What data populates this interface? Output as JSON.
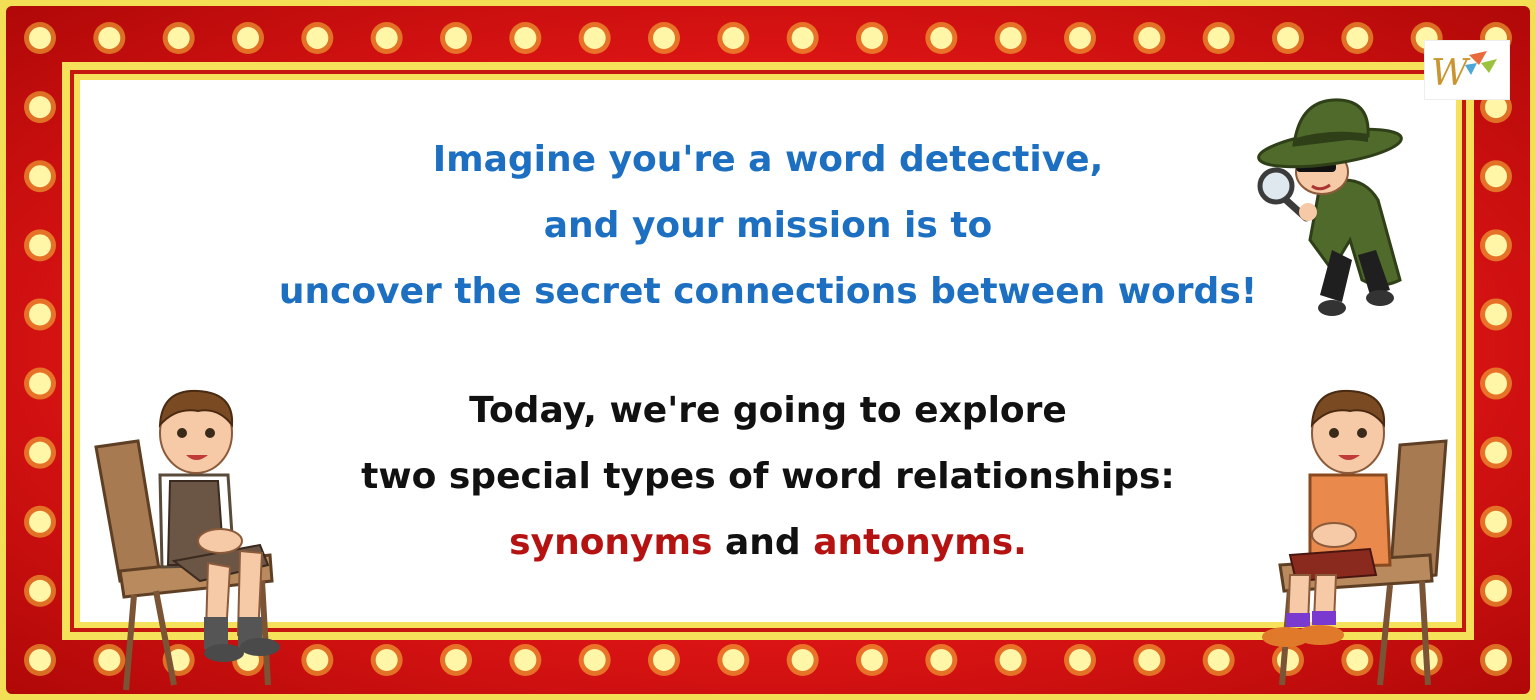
{
  "intro": {
    "line1": "Imagine you're a word detective,",
    "line2": "and your mission is to",
    "line3": "uncover the secret connections between words!"
  },
  "body": {
    "line1": "Today, we're going to explore",
    "line2": "two special types of word relationships:",
    "synonyms": "synonyms",
    "and": " and ",
    "antonyms": "antonyms",
    "period": "."
  },
  "colors": {
    "intro_text": "#1c6fc1",
    "body_text": "#111111",
    "keyword": "#b51212",
    "frame_red": "#e01515",
    "frame_yellow": "#f6e25a",
    "bulb": "#fff6a8"
  },
  "icons": [
    "logo-icon",
    "detective-icon",
    "boy-on-chair-left-icon",
    "boy-on-chair-right-icon",
    "marquee-bulb-icon"
  ]
}
